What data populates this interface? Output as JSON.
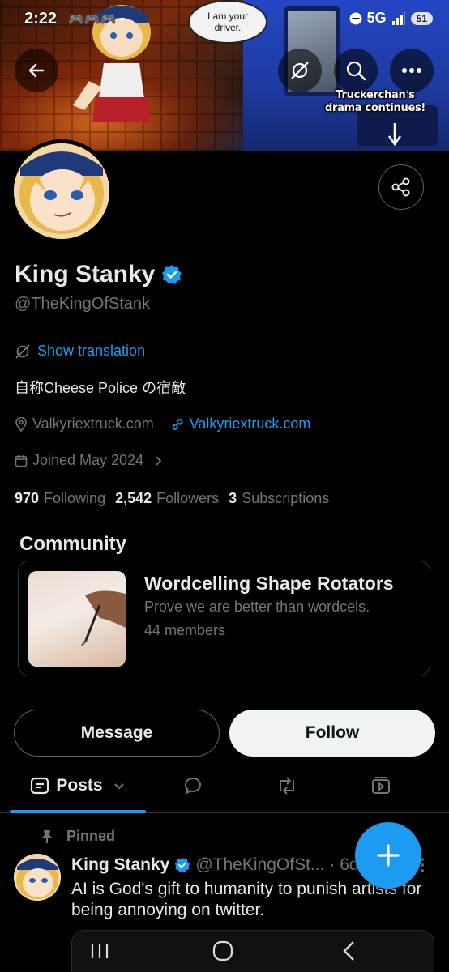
{
  "status_bar": {
    "time": "2:22",
    "notif_icons": "🎮🎮🎮 •",
    "network": "5G",
    "battery": "51"
  },
  "banner": {
    "speech_bubble": "I am your driver.",
    "caption": "Truckerchan's drama continues!"
  },
  "profile": {
    "name": "King Stanky",
    "handle": "@TheKingOfStank",
    "show_translation": "Show translation",
    "bio": "自称Cheese Police の宿敵",
    "location": "Valkyriextruck.com",
    "website": "Valkyriextruck.com",
    "joined": "Joined May 2024",
    "following_count": "970",
    "following_label": "Following",
    "followers_count": "2,542",
    "followers_label": "Followers",
    "subscriptions_count": "3",
    "subscriptions_label": "Subscriptions"
  },
  "community": {
    "section_title": "Community",
    "name": "Wordcelling Shape Rotators",
    "description": "Prove we are better than wordcels.",
    "members": "44 members"
  },
  "actions": {
    "message": "Message",
    "follow": "Follow"
  },
  "tabs": {
    "posts": "Posts"
  },
  "pinned_post": {
    "pinned_label": "Pinned",
    "author": "King Stanky",
    "handle": "@TheKingOfSt...",
    "time": "· 6d",
    "text": "AI is God's gift to humanity to punish artists for being annoying on twitter."
  },
  "colors": {
    "accent": "#1d9bf0",
    "background": "#000000",
    "muted": "#71767b"
  }
}
